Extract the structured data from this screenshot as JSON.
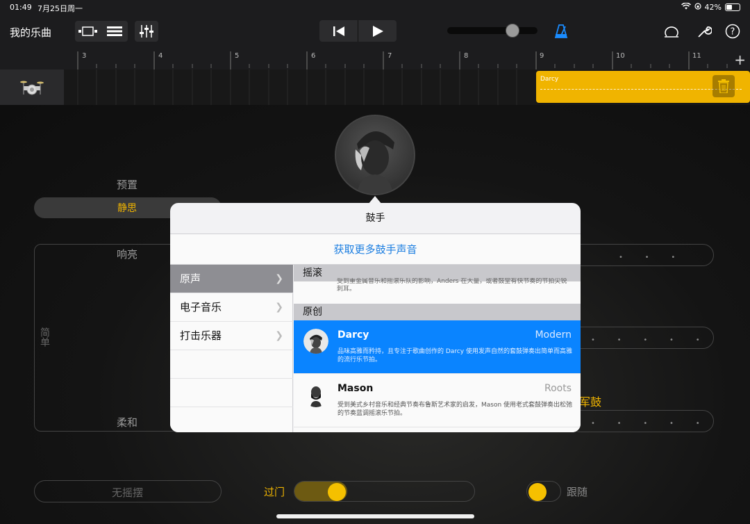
{
  "status_bar": {
    "time": "01:49",
    "date": "7月25日周一",
    "battery": "42%",
    "battery_level": 0.42
  },
  "toolbar": {
    "title": "我的乐曲"
  },
  "ruler": {
    "bars": [
      "3",
      "4",
      "5",
      "6",
      "7",
      "8",
      "9",
      "10",
      "11"
    ],
    "add_label": "+"
  },
  "region": {
    "label": "Darcy"
  },
  "main": {
    "preset_label": "预置",
    "preset_value": "静思",
    "loud_label": "响亮",
    "soft_label": "柔和",
    "simple_label": "简单",
    "snare_label": "军鼓",
    "no_swing_label": "无摇摆",
    "fill_label": "过门",
    "follow_label": "跟随"
  },
  "popover": {
    "title": "鼓手",
    "get_more_link": "获取更多鼓手声音",
    "categories": [
      {
        "label": "原声",
        "selected": true
      },
      {
        "label": "电子音乐",
        "selected": false
      },
      {
        "label": "打击乐器",
        "selected": false
      }
    ],
    "sections": [
      {
        "header": "摇滚",
        "cut_description": "受到重金属音乐和摇滚乐队的影响，Anders 在大量，或者鼓堂有快节奏的节拍尖锐刺耳。"
      },
      {
        "header": "原创"
      }
    ],
    "drummers": [
      {
        "name": "Darcy",
        "style": "Modern",
        "description": "品味高雅而矜持，且专注于歌曲创作的 Darcy 使用发声自然的套鼓弹奏出简单而高雅的流行乐节拍。",
        "selected": true
      },
      {
        "name": "Mason",
        "style": "Roots",
        "description": "受到美式乡村音乐和经典节奏布鲁斯艺术家的启发，Mason 使用老式套鼓弹奏出松弛的节奏蓝调摇滚乐节拍。",
        "selected": false
      }
    ]
  },
  "colors": {
    "accent": "#f0b400",
    "selection_blue": "#0a84ff",
    "link_blue": "#1a7de0"
  }
}
